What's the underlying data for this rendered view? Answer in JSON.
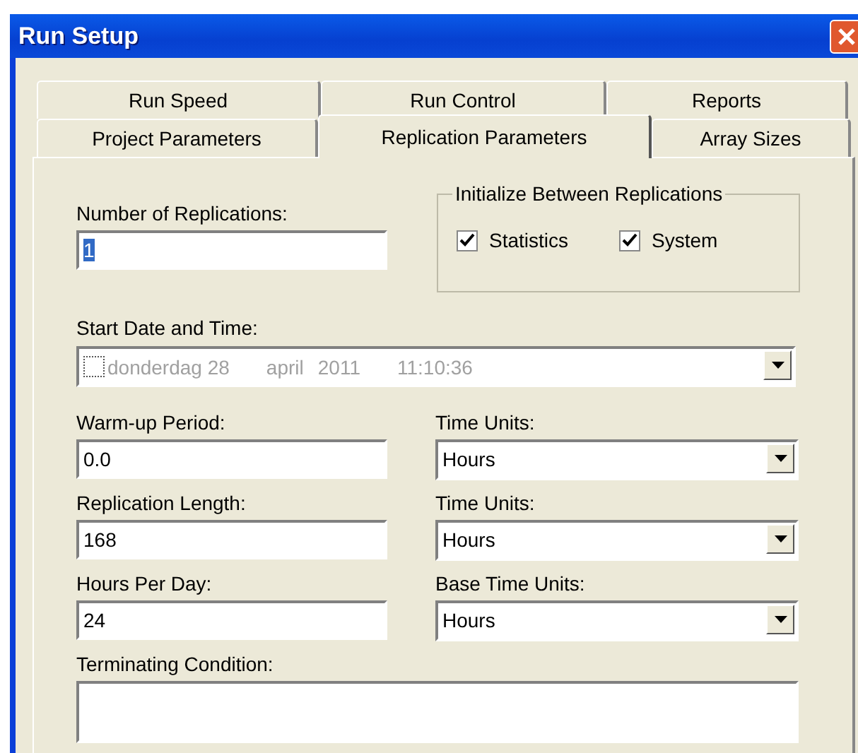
{
  "window": {
    "title": "Run Setup"
  },
  "tab_rows": [
    [
      {
        "label": "Run Speed",
        "selected": false
      },
      {
        "label": "Run Control",
        "selected": false
      },
      {
        "label": "Reports",
        "selected": false
      }
    ],
    [
      {
        "label": "Project Parameters",
        "selected": false
      },
      {
        "label": "Replication Parameters",
        "selected": true
      },
      {
        "label": "Array Sizes",
        "selected": false
      }
    ]
  ],
  "replications": {
    "label": "Number of Replications:",
    "value": "1",
    "highlighted": true
  },
  "initialize_group": {
    "title": "Initialize Between Replications",
    "options": [
      {
        "label": "Statistics",
        "checked": true
      },
      {
        "label": "System",
        "checked": true
      }
    ]
  },
  "start_date": {
    "label": "Start Date and Time:",
    "checked": false,
    "disabled": true,
    "parts": [
      "donderdag 28",
      "april",
      "2011",
      "11:10:36"
    ]
  },
  "rows": [
    {
      "field_label": "Warm-up Period:",
      "value": "0.0",
      "units_label": "Time Units:",
      "units": "Hours"
    },
    {
      "field_label": "Replication Length:",
      "value": "168",
      "units_label": "Time Units:",
      "units": "Hours"
    },
    {
      "field_label": "Hours Per Day:",
      "value": "24",
      "units_label": "Base Time Units:",
      "units": "Hours"
    }
  ],
  "terminating": {
    "label": "Terminating Condition:"
  }
}
